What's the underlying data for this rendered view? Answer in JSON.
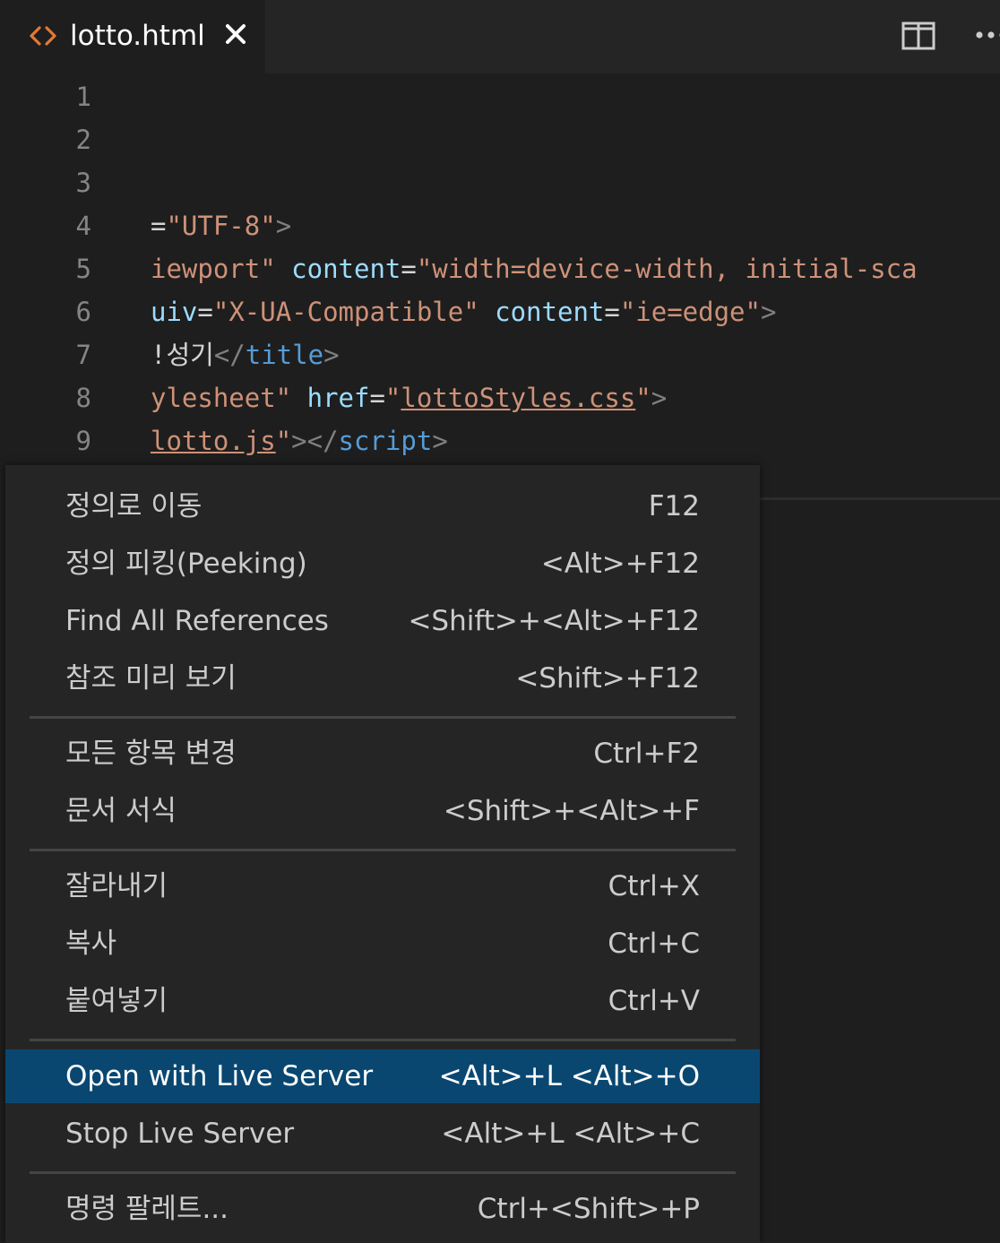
{
  "tab": {
    "title": "lotto.html"
  },
  "editor": {
    "line_numbers": [
      "1",
      "2",
      "3",
      "4",
      "5",
      "6",
      "7",
      "8",
      "9"
    ],
    "lines": [
      [],
      [],
      [],
      [
        {
          "t": "=",
          "c": "txt"
        },
        {
          "t": "\"UTF-8\"",
          "c": "str"
        },
        {
          "t": ">",
          "c": "pun"
        }
      ],
      [
        {
          "t": "iewport\"",
          "c": "str"
        },
        {
          "t": " ",
          "c": "txt"
        },
        {
          "t": "content",
          "c": "attr"
        },
        {
          "t": "=",
          "c": "txt"
        },
        {
          "t": "\"width=device-width, initial-sca",
          "c": "str"
        }
      ],
      [
        {
          "t": "uiv",
          "c": "attr"
        },
        {
          "t": "=",
          "c": "txt"
        },
        {
          "t": "\"X-UA-Compatible\"",
          "c": "str"
        },
        {
          "t": " ",
          "c": "txt"
        },
        {
          "t": "content",
          "c": "attr"
        },
        {
          "t": "=",
          "c": "txt"
        },
        {
          "t": "\"ie=edge\"",
          "c": "str"
        },
        {
          "t": ">",
          "c": "pun"
        }
      ],
      [
        {
          "t": "!성기",
          "c": "txt"
        },
        {
          "t": "</",
          "c": "pun"
        },
        {
          "t": "title",
          "c": "tag"
        },
        {
          "t": ">",
          "c": "pun"
        }
      ],
      [
        {
          "t": "ylesheet\"",
          "c": "str"
        },
        {
          "t": " ",
          "c": "txt"
        },
        {
          "t": "href",
          "c": "attr"
        },
        {
          "t": "=",
          "c": "txt"
        },
        {
          "t": "\"",
          "c": "str"
        },
        {
          "t": "lottoStyles.css",
          "c": "link"
        },
        {
          "t": "\"",
          "c": "str"
        },
        {
          "t": ">",
          "c": "pun"
        }
      ],
      [
        {
          "t": "lotto.js",
          "c": "link"
        },
        {
          "t": "\"",
          "c": "str"
        },
        {
          "t": "></",
          "c": "pun"
        },
        {
          "t": "script",
          "c": "tag"
        },
        {
          "t": ">",
          "c": "pun"
        }
      ]
    ]
  },
  "context_menu": {
    "groups": [
      [
        {
          "label": "정의로 이동",
          "shortcut": "F12"
        },
        {
          "label": "정의 피킹(Peeking)",
          "shortcut": "<Alt>+F12"
        },
        {
          "label": "Find All References",
          "shortcut": "<Shift>+<Alt>+F12"
        },
        {
          "label": "참조 미리 보기",
          "shortcut": "<Shift>+F12"
        }
      ],
      [
        {
          "label": "모든 항목 변경",
          "shortcut": "Ctrl+F2"
        },
        {
          "label": "문서 서식",
          "shortcut": "<Shift>+<Alt>+F"
        }
      ],
      [
        {
          "label": "잘라내기",
          "shortcut": "Ctrl+X"
        },
        {
          "label": "복사",
          "shortcut": "Ctrl+C"
        },
        {
          "label": "붙여넣기",
          "shortcut": "Ctrl+V"
        }
      ],
      [
        {
          "label": "Open with Live Server",
          "shortcut": "<Alt>+L <Alt>+O",
          "active": true
        },
        {
          "label": "Stop Live Server",
          "shortcut": "<Alt>+L <Alt>+C"
        }
      ],
      [
        {
          "label": "명령 팔레트...",
          "shortcut": "Ctrl+<Shift>+P"
        }
      ]
    ]
  },
  "colors": {
    "editor_bg": "#1e1e1e",
    "tab_icon": "#e37933",
    "menu_bg": "#252526",
    "menu_active": "#094771",
    "string": "#ce9178",
    "attribute": "#9cdcfe",
    "tag": "#569cd6"
  },
  "icons": {
    "tab": "code-brackets-icon",
    "close": "close-icon",
    "split": "split-editor-icon",
    "more": "more-actions-icon"
  }
}
